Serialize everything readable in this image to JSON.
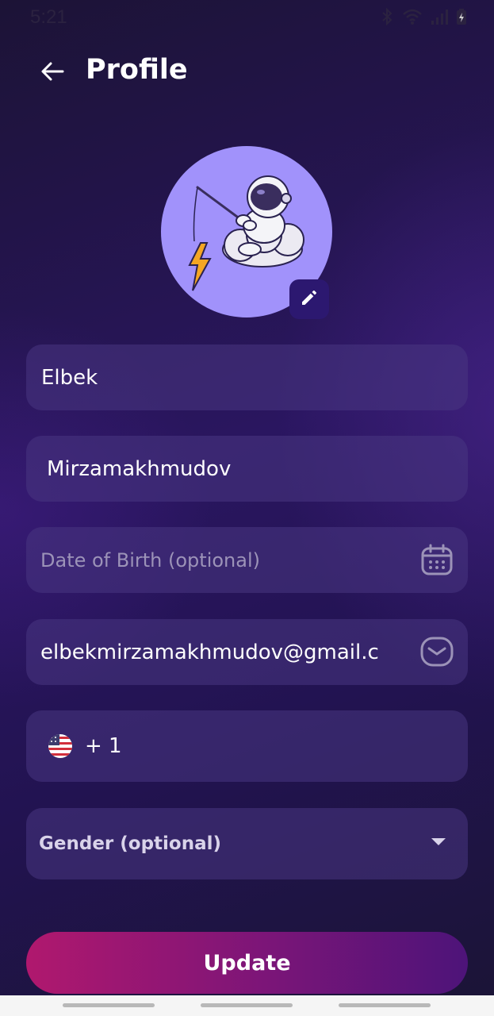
{
  "status_bar": {
    "time": "5:21",
    "icons": [
      "bluetooth-icon",
      "wifi-icon",
      "signal-icon",
      "battery-charging-icon"
    ]
  },
  "header": {
    "title": "Profile",
    "back_icon": "arrow-left-icon"
  },
  "avatar": {
    "image": "astronaut-fishing-on-cloud-illustration",
    "background": "#a192fb",
    "edit_icon": "pencil-icon"
  },
  "form": {
    "first_name": {
      "value": "Elbek"
    },
    "last_name": {
      "value": "Mirzamakhmudov"
    },
    "date_of_birth": {
      "placeholder": "Date of Birth (optional)",
      "icon": "calendar-icon"
    },
    "email": {
      "value": "elbekmirzamakhmudov@gmail.c",
      "icon": "mail-icon"
    },
    "phone": {
      "flag": "us-flag-icon",
      "code": "+ 1"
    },
    "gender": {
      "label": "Gender  (optional)",
      "icon": "dropdown-arrow-icon"
    }
  },
  "actions": {
    "update_label": "Update"
  },
  "colors": {
    "accent_start": "#b0186e",
    "accent_end": "#4d1479",
    "field_background": "#3a2a6e",
    "avatar_background": "#a192fb"
  }
}
